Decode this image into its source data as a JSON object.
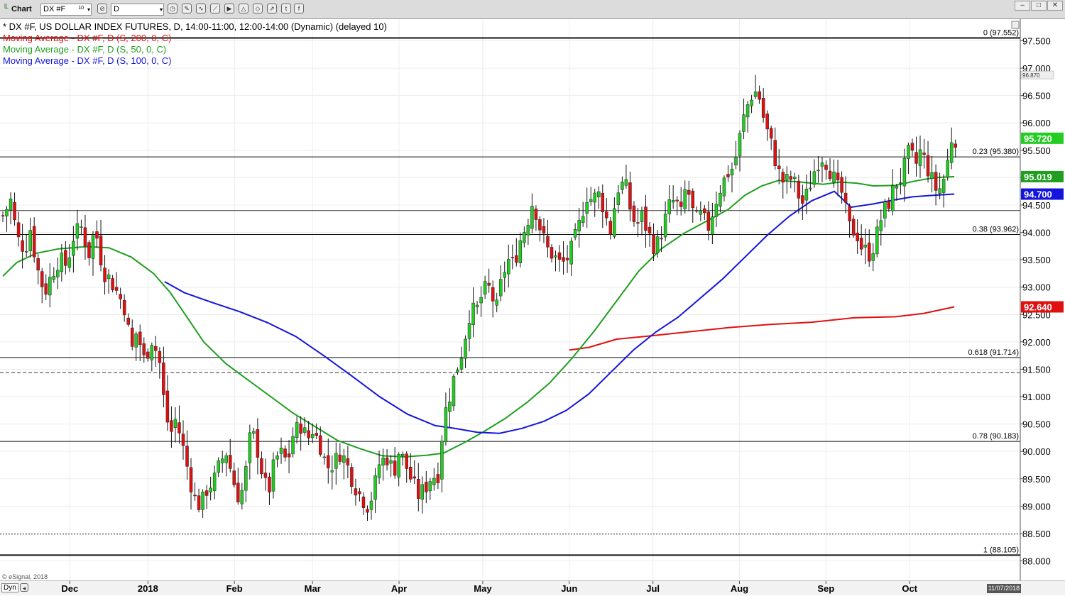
{
  "toolbar": {
    "app_label": "Chart",
    "symbol": "DX #F",
    "symbol_badge": "10",
    "interval": "D"
  },
  "legend": {
    "main": "* DX #F, US DOLLAR INDEX FUTURES, D, 14:00-11:00, 12:00-14:00 (Dynamic) (delayed 10)",
    "ma200": "Moving Average - DX #F, D (S, 200, 0, C)",
    "ma50": "Moving Average - DX #F, D (S, 50, 0, C)",
    "ma100": "Moving Average - DX #F, D (S, 100, 0, C)"
  },
  "footer": {
    "copyright": "© eSignal, 2018",
    "dyn_label": "Dyn",
    "date": "11/07/2018"
  },
  "colors": {
    "up": "#22cc22",
    "down": "#e01010",
    "ma200": "#e01010",
    "ma50": "#1f9e1f",
    "ma100": "#1414dc"
  },
  "chart_data": {
    "type": "candlestick",
    "title": "DX #F, US DOLLAR INDEX FUTURES, D",
    "ylim": [
      88.0,
      97.7
    ],
    "y_ticks": [
      "88.000",
      "88.500",
      "89.000",
      "89.500",
      "90.000",
      "90.500",
      "91.000",
      "91.500",
      "92.000",
      "92.500",
      "93.000",
      "93.500",
      "94.000",
      "94.500",
      "95.000",
      "95.500",
      "96.000",
      "96.500",
      "97.000",
      "97.500"
    ],
    "month_labels": [
      {
        "label": "Dec",
        "day": 24
      },
      {
        "label": "2018",
        "day": 52
      },
      {
        "label": "Feb",
        "day": 83
      },
      {
        "label": "Mar",
        "day": 111
      },
      {
        "label": "Apr",
        "day": 142
      },
      {
        "label": "May",
        "day": 172
      },
      {
        "label": "Jun",
        "day": 203
      },
      {
        "label": "Jul",
        "day": 233
      },
      {
        "label": "Aug",
        "day": 264
      },
      {
        "label": "Sep",
        "day": 295
      },
      {
        "label": "Oct",
        "day": 325
      }
    ],
    "x_range_days": [
      0,
      342
    ],
    "close_path": [
      [
        0,
        94.3
      ],
      [
        3,
        94.6
      ],
      [
        5,
        93.9
      ],
      [
        8,
        93.7
      ],
      [
        10,
        94.1
      ],
      [
        12,
        93.4
      ],
      [
        15,
        92.9
      ],
      [
        18,
        93.3
      ],
      [
        20,
        93.5
      ],
      [
        23,
        93.4
      ],
      [
        25,
        93.9
      ],
      [
        28,
        94.1
      ],
      [
        31,
        93.6
      ],
      [
        33,
        94.1
      ],
      [
        36,
        93.3
      ],
      [
        39,
        93.1
      ],
      [
        41,
        92.9
      ],
      [
        44,
        92.6
      ],
      [
        46,
        91.8
      ],
      [
        48,
        92.2
      ],
      [
        51,
        91.6
      ],
      [
        53,
        92.1
      ],
      [
        56,
        91.7
      ],
      [
        58,
        90.8
      ],
      [
        60,
        90.3
      ],
      [
        62,
        90.6
      ],
      [
        64,
        90.2
      ],
      [
        67,
        89.5
      ],
      [
        69,
        89.1
      ],
      [
        71,
        89.0
      ],
      [
        73,
        89.3
      ],
      [
        76,
        89.5
      ],
      [
        78,
        89.8
      ],
      [
        80,
        90.0
      ],
      [
        83,
        89.4
      ],
      [
        85,
        89.1
      ],
      [
        87,
        89.6
      ],
      [
        89,
        90.4
      ],
      [
        91,
        90.1
      ],
      [
        93,
        89.6
      ],
      [
        95,
        89.2
      ],
      [
        97,
        89.7
      ],
      [
        99,
        90.0
      ],
      [
        102,
        89.8
      ],
      [
        104,
        90.3
      ],
      [
        107,
        90.5
      ],
      [
        109,
        90.2
      ],
      [
        111,
        90.4
      ],
      [
        114,
        90.1
      ],
      [
        116,
        89.7
      ],
      [
        119,
        89.8
      ],
      [
        121,
        90.0
      ],
      [
        123,
        89.8
      ],
      [
        126,
        89.4
      ],
      [
        128,
        89.2
      ],
      [
        131,
        89.0
      ],
      [
        133,
        89.3
      ],
      [
        135,
        89.8
      ],
      [
        138,
        89.9
      ],
      [
        140,
        89.6
      ],
      [
        142,
        90.0
      ],
      [
        144,
        89.8
      ],
      [
        147,
        89.4
      ],
      [
        149,
        89.2
      ],
      [
        151,
        89.3
      ],
      [
        153,
        89.5
      ],
      [
        156,
        89.6
      ],
      [
        158,
        90.6
      ],
      [
        160,
        91.0
      ],
      [
        162,
        91.4
      ],
      [
        165,
        91.9
      ],
      [
        167,
        92.5
      ],
      [
        170,
        92.6
      ],
      [
        172,
        92.9
      ],
      [
        174,
        93.0
      ],
      [
        177,
        92.6
      ],
      [
        179,
        93.2
      ],
      [
        181,
        93.5
      ],
      [
        183,
        93.4
      ],
      [
        185,
        93.8
      ],
      [
        188,
        94.2
      ],
      [
        190,
        94.6
      ],
      [
        193,
        94.0
      ],
      [
        195,
        93.7
      ],
      [
        197,
        93.6
      ],
      [
        200,
        93.4
      ],
      [
        202,
        93.5
      ],
      [
        204,
        93.7
      ],
      [
        207,
        94.2
      ],
      [
        209,
        94.7
      ],
      [
        211,
        94.6
      ],
      [
        214,
        94.7
      ],
      [
        216,
        94.3
      ],
      [
        218,
        94.0
      ],
      [
        220,
        94.8
      ],
      [
        223,
        94.9
      ],
      [
        225,
        94.4
      ],
      [
        227,
        94.1
      ],
      [
        229,
        94.3
      ],
      [
        232,
        93.9
      ],
      [
        234,
        93.7
      ],
      [
        236,
        94.0
      ],
      [
        239,
        94.5
      ],
      [
        241,
        94.6
      ],
      [
        243,
        94.3
      ],
      [
        245,
        94.9
      ],
      [
        248,
        94.2
      ],
      [
        250,
        94.3
      ],
      [
        253,
        94.1
      ],
      [
        255,
        94.5
      ],
      [
        257,
        94.8
      ],
      [
        260,
        95.1
      ],
      [
        262,
        95.2
      ],
      [
        264,
        95.7
      ],
      [
        266,
        96.2
      ],
      [
        269,
        96.6
      ],
      [
        271,
        96.5
      ],
      [
        273,
        96.0
      ],
      [
        276,
        95.5
      ],
      [
        278,
        95.1
      ],
      [
        280,
        94.9
      ],
      [
        283,
        95.0
      ],
      [
        285,
        94.7
      ],
      [
        287,
        94.5
      ],
      [
        290,
        95.0
      ],
      [
        292,
        95.3
      ],
      [
        294,
        95.4
      ],
      [
        297,
        95.1
      ],
      [
        299,
        94.8
      ],
      [
        301,
        94.7
      ],
      [
        303,
        94.1
      ],
      [
        306,
        94.0
      ],
      [
        308,
        93.7
      ],
      [
        311,
        93.6
      ],
      [
        313,
        93.9
      ],
      [
        315,
        94.3
      ],
      [
        318,
        94.6
      ],
      [
        320,
        94.9
      ],
      [
        322,
        95.0
      ],
      [
        325,
        95.5
      ],
      [
        327,
        95.2
      ],
      [
        329,
        95.5
      ],
      [
        332,
        95.1
      ],
      [
        334,
        94.8
      ],
      [
        336,
        94.8
      ],
      [
        338,
        95.1
      ],
      [
        340,
        95.72
      ]
    ],
    "series": [
      {
        "name": "Moving Average - DX #F, D (S, 200, 0, C)",
        "points": [
          [
            203,
            91.85
          ],
          [
            210,
            91.9
          ],
          [
            220,
            92.05
          ],
          [
            230,
            92.1
          ],
          [
            245,
            92.18
          ],
          [
            260,
            92.26
          ],
          [
            275,
            92.32
          ],
          [
            290,
            92.36
          ],
          [
            305,
            92.44
          ],
          [
            320,
            92.46
          ],
          [
            330,
            92.52
          ],
          [
            341,
            92.64
          ]
        ]
      },
      {
        "name": "Moving Average - DX #F, D (S, 50, 0, C)",
        "points": [
          [
            0,
            93.2
          ],
          [
            5,
            93.45
          ],
          [
            12,
            93.62
          ],
          [
            20,
            93.7
          ],
          [
            30,
            93.74
          ],
          [
            38,
            93.72
          ],
          [
            46,
            93.55
          ],
          [
            54,
            93.25
          ],
          [
            60,
            92.9
          ],
          [
            66,
            92.45
          ],
          [
            72,
            92.0
          ],
          [
            80,
            91.6
          ],
          [
            88,
            91.3
          ],
          [
            96,
            91.0
          ],
          [
            104,
            90.7
          ],
          [
            112,
            90.45
          ],
          [
            120,
            90.2
          ],
          [
            128,
            90.05
          ],
          [
            136,
            89.92
          ],
          [
            144,
            89.9
          ],
          [
            152,
            89.93
          ],
          [
            158,
            89.97
          ],
          [
            165,
            90.15
          ],
          [
            172,
            90.35
          ],
          [
            180,
            90.6
          ],
          [
            188,
            90.9
          ],
          [
            196,
            91.25
          ],
          [
            204,
            91.7
          ],
          [
            212,
            92.2
          ],
          [
            220,
            92.75
          ],
          [
            228,
            93.3
          ],
          [
            236,
            93.7
          ],
          [
            244,
            93.98
          ],
          [
            252,
            94.2
          ],
          [
            260,
            94.42
          ],
          [
            266,
            94.68
          ],
          [
            272,
            94.85
          ],
          [
            278,
            94.95
          ],
          [
            286,
            94.92
          ],
          [
            294,
            94.88
          ],
          [
            300,
            94.92
          ],
          [
            306,
            94.9
          ],
          [
            312,
            94.85
          ],
          [
            320,
            94.86
          ],
          [
            328,
            94.95
          ],
          [
            334,
            95.0
          ],
          [
            341,
            95.019
          ]
        ]
      },
      {
        "name": "Moving Average - DX #F, D (S, 100, 0, C)",
        "points": [
          [
            58,
            93.1
          ],
          [
            65,
            92.9
          ],
          [
            75,
            92.72
          ],
          [
            85,
            92.55
          ],
          [
            95,
            92.35
          ],
          [
            105,
            92.1
          ],
          [
            115,
            91.75
          ],
          [
            125,
            91.38
          ],
          [
            135,
            91.0
          ],
          [
            145,
            90.68
          ],
          [
            155,
            90.47
          ],
          [
            162,
            90.42
          ],
          [
            170,
            90.35
          ],
          [
            178,
            90.33
          ],
          [
            186,
            90.42
          ],
          [
            194,
            90.55
          ],
          [
            202,
            90.75
          ],
          [
            210,
            91.05
          ],
          [
            218,
            91.45
          ],
          [
            226,
            91.85
          ],
          [
            234,
            92.18
          ],
          [
            242,
            92.45
          ],
          [
            250,
            92.8
          ],
          [
            258,
            93.15
          ],
          [
            266,
            93.55
          ],
          [
            274,
            93.95
          ],
          [
            282,
            94.3
          ],
          [
            290,
            94.58
          ],
          [
            298,
            94.75
          ],
          [
            304,
            94.46
          ],
          [
            312,
            94.52
          ],
          [
            318,
            94.58
          ],
          [
            326,
            94.65
          ],
          [
            334,
            94.68
          ],
          [
            341,
            94.7
          ]
        ]
      }
    ],
    "price_badges": [
      {
        "value": "95.720",
        "color": "#22cc22"
      },
      {
        "value": "95.019",
        "color": "#1f9e1f"
      },
      {
        "value": "94.700",
        "color": "#1414dc"
      },
      {
        "value": "92.640",
        "color": "#e01010"
      }
    ],
    "high_tag": "96.870",
    "fib_levels": [
      {
        "label": "0 (97.552)",
        "value": 97.552
      },
      {
        "label": "0.23 (95.380)",
        "value": 95.38
      },
      {
        "label": "0.38 (93.962)",
        "value": 93.962
      },
      {
        "label": "0.618 (91.714)",
        "value": 91.714
      },
      {
        "label": "0.78 (90.183)",
        "value": 90.183
      },
      {
        "label": "1 (88.105)",
        "value": 88.105
      }
    ],
    "horizontal_lines": [
      {
        "value": 94.4,
        "style": "solid-thin"
      },
      {
        "value": 91.44,
        "style": "dashed"
      },
      {
        "value": 88.49,
        "style": "dotted"
      }
    ]
  }
}
